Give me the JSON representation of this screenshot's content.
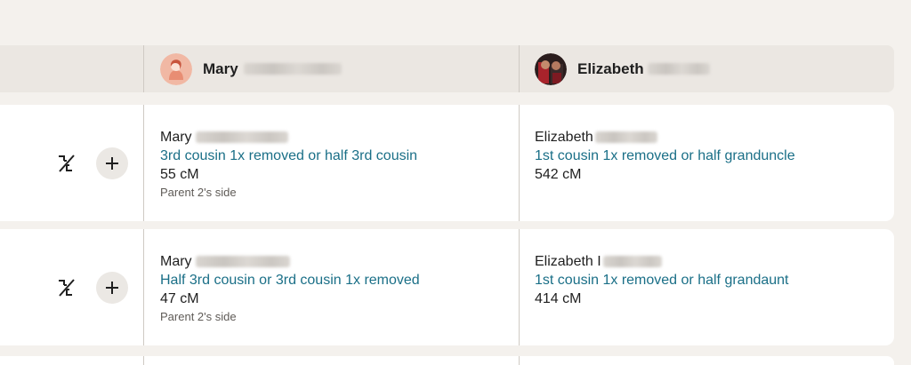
{
  "header": {
    "col1": {
      "name": "Mary"
    },
    "col2": {
      "name": "Elizabeth"
    }
  },
  "rows": [
    {
      "col1": {
        "name": "Mary",
        "relationship": "3rd cousin 1x removed or half 3rd cousin",
        "cm": "55 cM",
        "side": "Parent 2's side"
      },
      "col2": {
        "name": "Elizabeth",
        "relationship": "1st cousin 1x removed or half granduncle",
        "cm": "542 cM"
      }
    },
    {
      "col1": {
        "name": "Mary",
        "relationship": "Half 3rd cousin or 3rd cousin 1x removed",
        "cm": "47 cM",
        "side": "Parent 2's side"
      },
      "col2": {
        "name": "Elizabeth I",
        "relationship": "1st cousin 1x removed or half grandaunt",
        "cm": "414 cM"
      }
    }
  ],
  "icons": {
    "shared_match": "shared-dna-icon",
    "add": "plus-icon"
  },
  "colors": {
    "relationship_link": "#1a6f87",
    "page_bg": "#f4f1ed",
    "header_bg": "#ebe7e2"
  }
}
